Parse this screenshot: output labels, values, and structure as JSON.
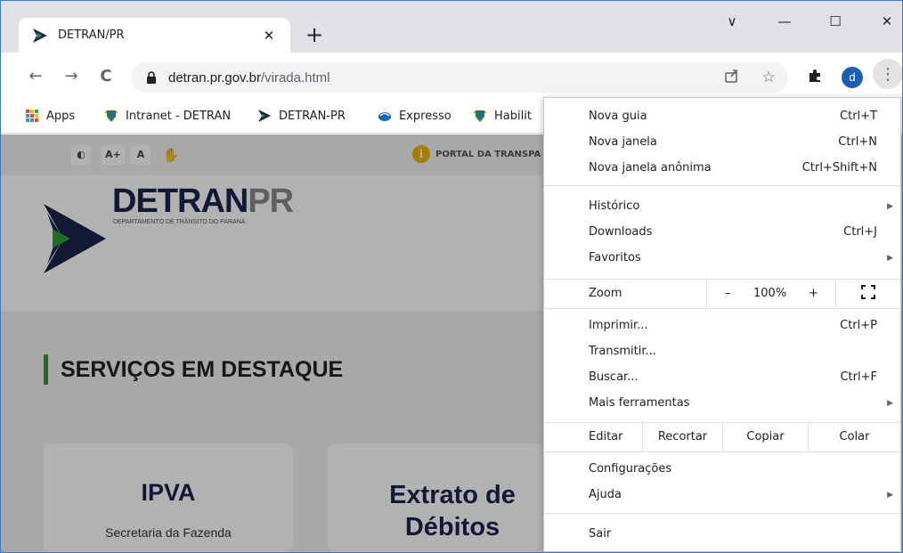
{
  "tab": {
    "title": "DETRAN/PR",
    "close": "✕",
    "new_tab": "+"
  },
  "window_controls": {
    "chevron": "∨",
    "minimize": "—",
    "maximize": "☐",
    "close": "✕"
  },
  "toolbar": {
    "back": "←",
    "forward": "→",
    "reload": "C",
    "url_host": "detran.pr.gov.br",
    "url_path": "/virada.html",
    "profile_initial": "d",
    "menu_glyph": "⋮"
  },
  "bookmarks": [
    {
      "label": "Apps",
      "icon": "apps-grid-icon"
    },
    {
      "label": "Intranet - DETRAN",
      "icon": "pr-crest-icon"
    },
    {
      "label": "DETRAN-PR",
      "icon": "detran-logo-icon"
    },
    {
      "label": "Expresso",
      "icon": "expresso-icon"
    },
    {
      "label": "Habilit",
      "icon": "pr-crest-icon"
    }
  ],
  "page": {
    "access_buttons": [
      "◐",
      "A+",
      "A",
      "✋"
    ],
    "portal_label": "PORTAL DA TRANSPA",
    "logo_main": "DETRAN",
    "logo_pr": "PR",
    "logo_subtitle": "DEPARTAMENTO DE TRÂNSITO DO PARANÁ",
    "section_title": "SERVIÇOS EM DESTAQUE",
    "cards": [
      {
        "title": "IPVA",
        "subtitle": "Secretaria da Fazenda"
      },
      {
        "title_line1": "Extrato de",
        "title_line2": "Débitos"
      }
    ]
  },
  "menu": {
    "group1": [
      {
        "label": "Nova guia",
        "shortcut": "Ctrl+T"
      },
      {
        "label": "Nova janela",
        "shortcut": "Ctrl+N"
      },
      {
        "label": "Nova janela anônima",
        "shortcut": "Ctrl+Shift+N"
      }
    ],
    "group2": [
      {
        "label": "Histórico",
        "arrow": "▶"
      },
      {
        "label": "Downloads",
        "shortcut": "Ctrl+J"
      },
      {
        "label": "Favoritos",
        "arrow": "▶"
      }
    ],
    "zoom": {
      "label": "Zoom",
      "minus": "–",
      "value": "100%",
      "plus": "+",
      "fullscreen": "⛶"
    },
    "group3": [
      {
        "label": "Imprimir...",
        "shortcut": "Ctrl+P"
      },
      {
        "label": "Transmitir..."
      },
      {
        "label": "Buscar...",
        "shortcut": "Ctrl+F"
      },
      {
        "label": "Mais ferramentas",
        "arrow": "▶"
      }
    ],
    "edit": {
      "label": "Editar",
      "cut": "Recortar",
      "copy": "Copiar",
      "paste": "Colar"
    },
    "group4": [
      {
        "label": "Configurações"
      },
      {
        "label": "Ajuda",
        "arrow": "▶"
      }
    ],
    "exit": {
      "label": "Sair"
    }
  }
}
